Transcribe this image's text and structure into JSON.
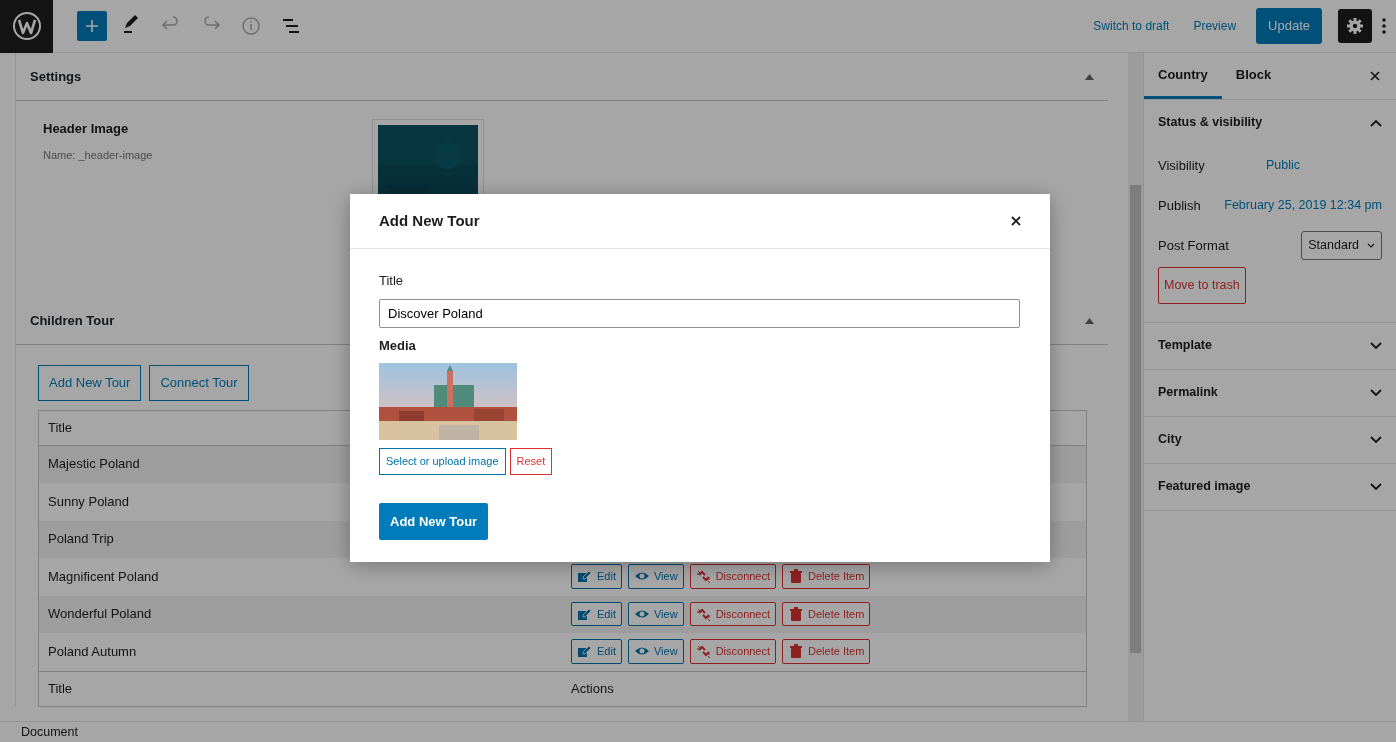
{
  "top_bar": {
    "links": [
      {
        "label": "Switch to draft"
      },
      {
        "label": "Preview"
      }
    ],
    "primary_button": "Update",
    "settings_active": true
  },
  "settings_panel": {
    "title": "Settings",
    "expanded": true,
    "field_label": "Header Image",
    "field_note": "Name: _header-image"
  },
  "children_panel": {
    "title": "Children Tour",
    "expanded": true,
    "buttons": [
      "Add New Tour",
      "Connect Tour"
    ],
    "table": {
      "header": [
        "Title"
      ],
      "rows": [
        {
          "title": "Majestic Poland",
          "actions": []
        },
        {
          "title": "Sunny Poland",
          "actions": []
        },
        {
          "title": "Poland Trip",
          "actions": []
        },
        {
          "title": "Magnificent Poland",
          "actions": [
            {
              "kind": "edit",
              "label": "Edit"
            },
            {
              "kind": "view",
              "label": "View"
            },
            {
              "kind": "disconnect",
              "label": "Disconnect"
            },
            {
              "kind": "delete",
              "label": "Delete Item"
            }
          ]
        },
        {
          "title": "Wonderful Poland",
          "actions": [
            {
              "kind": "edit",
              "label": "Edit"
            },
            {
              "kind": "view",
              "label": "View"
            },
            {
              "kind": "disconnect",
              "label": "Disconnect"
            },
            {
              "kind": "delete",
              "label": "Delete Item"
            }
          ]
        },
        {
          "title": "Poland Autumn",
          "actions": [
            {
              "kind": "edit",
              "label": "Edit"
            },
            {
              "kind": "view",
              "label": "View"
            },
            {
              "kind": "disconnect",
              "label": "Disconnect"
            },
            {
              "kind": "delete",
              "label": "Delete Item"
            }
          ]
        }
      ],
      "footer": [
        "Title",
        "Actions"
      ]
    }
  },
  "status_bar": "Document",
  "sidebar": {
    "tabs": [
      {
        "label": "Country",
        "selected": true
      },
      {
        "label": "Block",
        "selected": false
      }
    ],
    "panels": [
      {
        "title": "Status & visibility",
        "expanded": true,
        "rows": [
          {
            "kind": "link",
            "label": "Visibility",
            "value": "Public"
          },
          {
            "kind": "link",
            "label": "Publish",
            "value": "February 25, 2019 12:34 pm"
          },
          {
            "kind": "select",
            "label": "Post Format",
            "value": "Standard"
          },
          {
            "kind": "danger",
            "value": "Move to trash"
          }
        ]
      },
      {
        "title": "Template",
        "expanded": false
      },
      {
        "title": "Permalink",
        "expanded": false
      },
      {
        "title": "City",
        "expanded": false
      },
      {
        "title": "Featured image",
        "expanded": false
      }
    ]
  },
  "modal": {
    "title": "Add New Tour",
    "title_label": "Title",
    "title_value": "Discover Poland",
    "media_label": "Media",
    "media_buttons": [
      {
        "kind": "primary",
        "label": "Select or upload image"
      },
      {
        "kind": "danger",
        "label": "Reset"
      }
    ],
    "submit": "Add New Tour"
  }
}
